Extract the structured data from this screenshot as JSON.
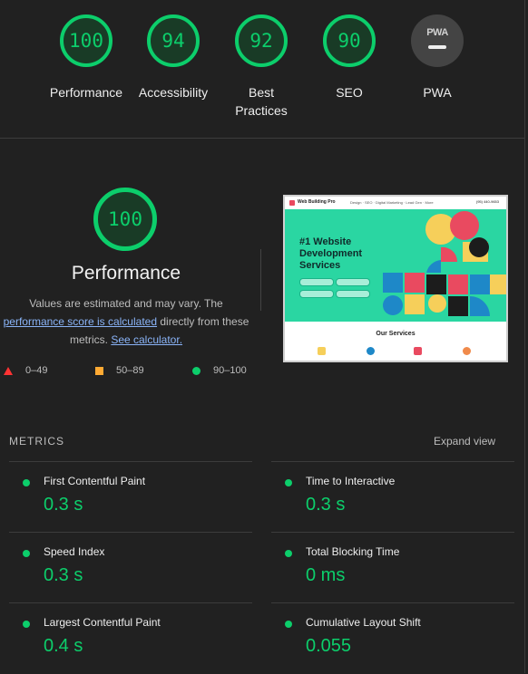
{
  "categories": [
    {
      "score": "100",
      "label": "Performance"
    },
    {
      "score": "94",
      "label": "Accessibility"
    },
    {
      "score": "92",
      "label": "Best Practices"
    },
    {
      "score": "90",
      "label": "SEO"
    },
    {
      "score": "",
      "label": "PWA",
      "badge_text": "PWA"
    }
  ],
  "performance": {
    "score": "100",
    "title": "Performance",
    "desc_before": "Values are estimated and may vary. The ",
    "desc_link": "performance score is calculated",
    "desc_middle": " directly from these metrics. ",
    "desc_link2": "See calculator."
  },
  "legend": {
    "fail": "0–49",
    "average": "50–89",
    "pass": "90–100"
  },
  "thumbnail": {
    "brand": "Web Building Pro",
    "menu": "Design ·   SEO ·   Digital Marketing ·   Lead Gen ·   More",
    "phone": "(95) 440-9653",
    "headline": "#1 Website Development Services",
    "section_title": "Our Services"
  },
  "metrics": {
    "heading": "METRICS",
    "expand_label": "Expand view",
    "items": [
      {
        "label": "First Contentful Paint",
        "value": "0.3 s"
      },
      {
        "label": "Time to Interactive",
        "value": "0.3 s"
      },
      {
        "label": "Speed Index",
        "value": "0.3 s"
      },
      {
        "label": "Total Blocking Time",
        "value": "0 ms"
      },
      {
        "label": "Largest Contentful Paint",
        "value": "0.4 s"
      },
      {
        "label": "Cumulative Layout Shift",
        "value": "0.055"
      }
    ]
  },
  "colors": {
    "pass": "#0cce6b",
    "average": "#ffaa33",
    "fail": "#ff3333",
    "background": "#212121"
  }
}
